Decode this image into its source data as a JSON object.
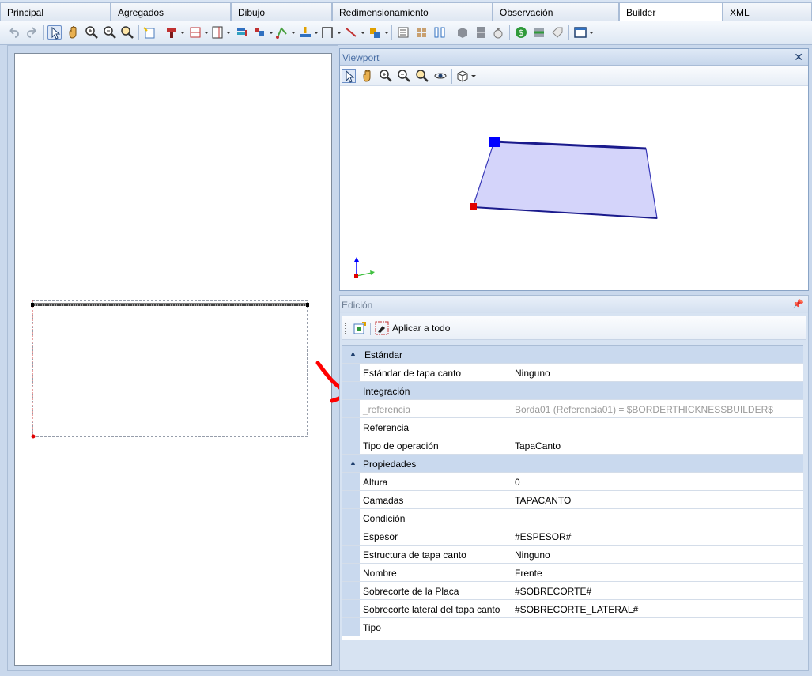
{
  "tabs": [
    "Principal",
    "Agregados",
    "Dibujo",
    "Redimensionamiento",
    "Observación",
    "Builder",
    "XML"
  ],
  "active_tab": "Builder",
  "viewport": {
    "title": "Viewport",
    "close_label": "✕"
  },
  "edicion": {
    "title": "Edición",
    "apply_label": "Aplicar a todo",
    "categories": {
      "estandar": "Estándar",
      "integracion": "Integración",
      "propiedades": "Propiedades"
    },
    "rows": {
      "estandar_tapa_canto": {
        "name": "Estándar de tapa canto",
        "value": "Ninguno"
      },
      "referencia_priv": {
        "name": "_referencia",
        "value": "Borda01 (Referencia01) = $BORDERTHICKNESSBUILDER$"
      },
      "referencia": {
        "name": "Referencia",
        "value": ""
      },
      "tipo_operacion": {
        "name": "Tipo de operación",
        "value": "TapaCanto"
      },
      "altura": {
        "name": "Altura",
        "value": "0"
      },
      "camadas": {
        "name": "Camadas",
        "value": "TAPACANTO"
      },
      "condicion": {
        "name": "Condición",
        "value": ""
      },
      "espesor": {
        "name": "Espesor",
        "value": "#ESPESOR#"
      },
      "estructura": {
        "name": "Estructura de tapa canto",
        "value": "Ninguno"
      },
      "nombre": {
        "name": "Nombre",
        "value": "Frente"
      },
      "sobrecorte_placa": {
        "name": "Sobrecorte de la Placa",
        "value": "#SOBRECORTE#"
      },
      "sobrecorte_lateral": {
        "name": "Sobrecorte lateral del tapa canto",
        "value": "#SOBRECORTE_LATERAL#"
      },
      "tipo": {
        "name": "Tipo",
        "value": ""
      }
    }
  },
  "colors": {
    "accent_blue": "#0000ff",
    "shape_fill": "#d4d4fa",
    "marker_red": "#e00000",
    "annotation_red": "#ff0000"
  }
}
